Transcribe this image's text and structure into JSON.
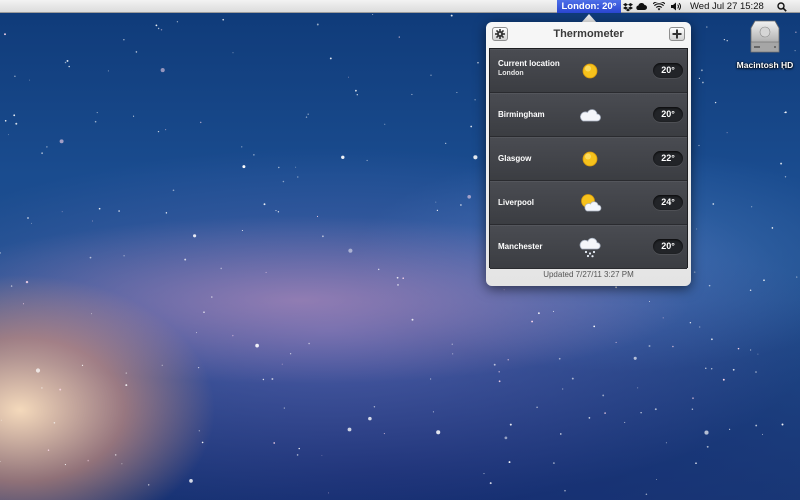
{
  "menubar": {
    "temperature_label": "London: 20°",
    "clock": "Wed Jul 27  15:28",
    "icons": [
      "dropbox-icon",
      "cloud-icon",
      "wifi-icon",
      "volume-icon",
      "spotlight-search-icon"
    ],
    "highlight_color": "#2f4bd6"
  },
  "desktop": {
    "drive_label": "Macintosh HD"
  },
  "popover": {
    "title": "Thermometer",
    "locations": [
      {
        "name": "Current location",
        "subtitle": "London",
        "condition": "sunny",
        "temp": "20°"
      },
      {
        "name": "Birmingham",
        "subtitle": "",
        "condition": "cloudy",
        "temp": "20°"
      },
      {
        "name": "Glasgow",
        "subtitle": "",
        "condition": "sunny",
        "temp": "22°"
      },
      {
        "name": "Liverpool",
        "subtitle": "",
        "condition": "partly-cloudy",
        "temp": "24°"
      },
      {
        "name": "Manchester",
        "subtitle": "",
        "condition": "snow",
        "temp": "20°"
      }
    ],
    "footer": "Updated 7/27/11 3:27 PM"
  }
}
